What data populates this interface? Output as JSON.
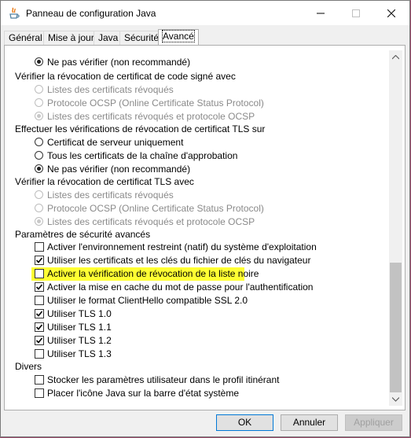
{
  "window": {
    "title": "Panneau de configuration Java",
    "app_icon": "java-icon",
    "controls": [
      "minimize-icon",
      "maximize-icon",
      "close-icon"
    ]
  },
  "tabs": [
    {
      "label": "Général",
      "active": false
    },
    {
      "label": "Mise à jour",
      "active": false
    },
    {
      "label": "Java",
      "active": false
    },
    {
      "label": "Sécurité",
      "active": false
    },
    {
      "label": "Avancé",
      "active": true
    }
  ],
  "settings": {
    "r0": "Ne pas vérifier (non recommandé)",
    "h1": "Vérifier la révocation de certificat de code signé avec",
    "r1a": "Listes des certificats révoqués",
    "r1b": "Protocole OCSP (Online Certificate Status Protocol)",
    "r1c": "Listes des certificats révoqués et protocole OCSP",
    "h2": "Effectuer les vérifications de révocation de certificat TLS sur",
    "r2a": "Certificat de serveur uniquement",
    "r2b": "Tous les certificats de la chaîne d'approbation",
    "r2c": "Ne pas vérifier (non recommandé)",
    "h3": "Vérifier la révocation de certificat TLS avec",
    "r3a": "Listes des certificats révoqués",
    "r3b": "Protocole OCSP (Online Certificate Status Protocol)",
    "r3c": "Listes des certificats révoqués et protocole OCSP",
    "h4": "Paramètres de sécurité avancés",
    "c1": "Activer l'environnement restreint (natif) du système d'exploitation",
    "c2": "Utiliser les certificats et les clés du fichier de clés du navigateur",
    "c3": "Activer la vérification de révocation de la liste noire",
    "c4": "Activer la mise en cache du mot de passe pour l'authentification",
    "c5": "Utiliser le format ClientHello compatible SSL 2.0",
    "c6": "Utiliser TLS 1.0",
    "c7": "Utiliser TLS 1.1",
    "c8": "Utiliser TLS 1.2",
    "c9": "Utiliser TLS 1.3",
    "h5": "Divers",
    "d1": "Stocker les paramètres utilisateur dans le profil itinérant",
    "d2": "Placer l'icône Java sur la barre d'état système"
  },
  "state": {
    "r0": true,
    "r1": "r1c",
    "r2": "r2c",
    "r3": "r3c",
    "checks": {
      "c1": false,
      "c2": true,
      "c3": false,
      "c4": true,
      "c5": false,
      "c6": true,
      "c7": true,
      "c8": true,
      "c9": false,
      "d1": false,
      "d2": false
    }
  },
  "highlighted_item": "c3",
  "buttons": {
    "ok": "OK",
    "cancel": "Annuler",
    "apply": "Appliquer"
  },
  "colors": {
    "highlight": "#ffff33",
    "focus_border": "#0078d7"
  }
}
